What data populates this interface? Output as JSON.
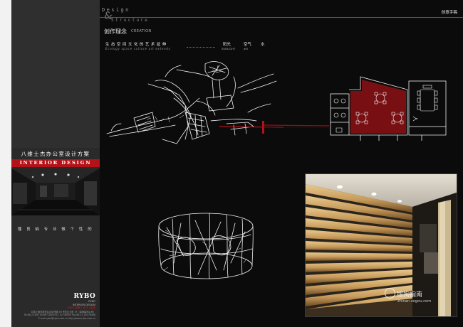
{
  "header": {
    "design_word": "Design",
    "amp": "&",
    "structure_word": "Structure",
    "top_right_label": "创意手稿",
    "concept_cn": "创作理念",
    "concept_en": "CREATION"
  },
  "concept": {
    "phrase_cn": "生态空间文化的艺术延伸",
    "phrase_en": "Ecology space culture art extends",
    "sun_cn": "阳光",
    "sun_en": "SUNLIGHT",
    "air_cn": "空气",
    "air_en": "aiR",
    "water_cn": "水"
  },
  "sidebar": {
    "title_cn": "八维士杰办公室设计方案",
    "banner": "INTERIOR DESIGN",
    "slogan": "懂 良 纳  专 业 做 个 性 的",
    "logo_word": "RYBO",
    "logo_sub_1": "RYBO",
    "logo_sub_2": "INTERIOR DESIGN",
    "logo_bar": "RYBO 瑞博 | 设计 | 装饰",
    "contact_1": "中国上海市静安区北京西路 99 号宏达大厦 3F（瑞博装饰公司）",
    "contact_2": "Tel:86-21-60278498   52800312 52736000   Fax:86-21-50278498",
    "contact_3": "E-mail:rybo@rybo.com.cn          http://www.rybo.com.cn"
  },
  "watermark": {
    "cn": "搜狗指南",
    "en": "zhinan.sogou.com"
  },
  "colors": {
    "accent_red": "#b31218",
    "background": "#0b0b0b",
    "sidebar": "#2a2a2a"
  }
}
